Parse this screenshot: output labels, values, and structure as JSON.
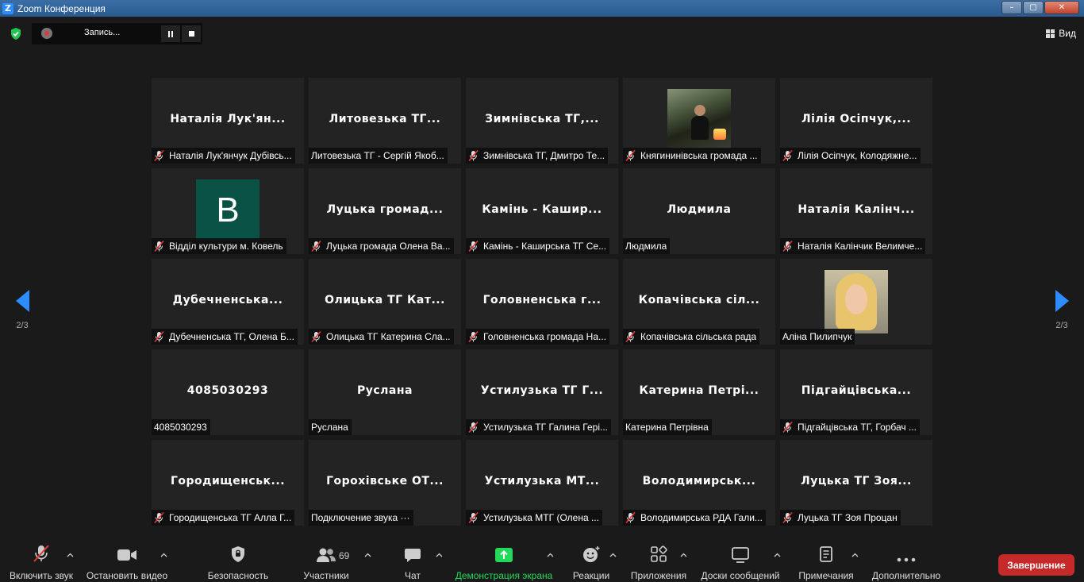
{
  "window": {
    "title": "Zoom Конференция",
    "min": "–",
    "max": "▢",
    "close": "✕"
  },
  "logo": "Z",
  "recording": {
    "label": "Запись..."
  },
  "view": {
    "label": "Вид"
  },
  "pager": {
    "left_label": "2/3",
    "right_label": "2/3"
  },
  "tiles": [
    {
      "big": "Наталія Лук'ян...",
      "name": "Наталія Лук'янчук Дубівсь...",
      "muted": true
    },
    {
      "big": "Литовезька ТГ...",
      "name": "Литовезька ТГ - Сергій Якоб...",
      "muted": false
    },
    {
      "big": "Зимнівська ТГ,...",
      "name": "Зимнівська ТГ, Дмитро Те...",
      "muted": true
    },
    {
      "big": "",
      "name": "Княгининівська громада ...",
      "muted": true,
      "photo": "photo1"
    },
    {
      "big": "Лілія Осіпчук,...",
      "name": "Лілія Осіпчук, Колодяжне...",
      "muted": true
    },
    {
      "big": "",
      "avatar_letter": "B",
      "name": "Відділ культури м. Ковель",
      "muted": true
    },
    {
      "big": "Луцька громад...",
      "name": "Луцька громада Олена Ва...",
      "muted": true
    },
    {
      "big": "Камінь - Кашир...",
      "name": "Камінь - Каширська ТГ Се...",
      "muted": true
    },
    {
      "big": "Людмила",
      "name": "Людмила",
      "muted": false
    },
    {
      "big": "Наталія Калінч...",
      "name": "Наталія Калінчик Велимче...",
      "muted": true
    },
    {
      "big": "Дубечненська...",
      "name": "Дубечненська ТГ, Олена Б...",
      "muted": true
    },
    {
      "big": "Олицька ТГ Кат...",
      "name": "Олицька ТГ Катерина Сла...",
      "muted": true
    },
    {
      "big": "Головненська г...",
      "name": "Головненська громада На...",
      "muted": true
    },
    {
      "big": "Копачівська сіл...",
      "name": "Копачівська сільська рада",
      "muted": true
    },
    {
      "big": "",
      "name": "Аліна Пилипчук",
      "muted": false,
      "photo": "photo2"
    },
    {
      "big": "4085030293",
      "name": "4085030293",
      "muted": false
    },
    {
      "big": "Руслана",
      "name": "Руслана",
      "muted": false
    },
    {
      "big": "Устилузька ТГ Г...",
      "name": "Устилузька ТГ Галина Гері...",
      "muted": true
    },
    {
      "big": "Катерина Петрі...",
      "name": "Катерина Петрівна",
      "muted": false
    },
    {
      "big": "Підгайцівська...",
      "name": "Підгайцівська ТГ, Горбач ...",
      "muted": true
    },
    {
      "big": "Городищенськ...",
      "name": "Городищенська ТГ Алла Г...",
      "muted": true
    },
    {
      "big": "Горохівське ОТ...",
      "name": "Подключение звука ···",
      "muted": false
    },
    {
      "big": "Устилузька МТ...",
      "name": "Устилузька МТГ  (Олена ...",
      "muted": true
    },
    {
      "big": "Володимирськ...",
      "name": "Володимирська РДА Гали...",
      "muted": true
    },
    {
      "big": "Луцька ТГ Зоя...",
      "name": "Луцька ТГ Зоя Процан",
      "muted": true
    }
  ],
  "toolbar": {
    "unmute": "Включить звук",
    "stop_video": "Остановить видео",
    "security": "Безопасность",
    "participants": "Участники",
    "participants_count": "69",
    "chat": "Чат",
    "share": "Демонстрация экрана",
    "reactions": "Реакции",
    "apps": "Приложения",
    "whiteboards": "Доски сообщений",
    "notes": "Примечания",
    "more": "Дополнительно",
    "end": "Завершение"
  },
  "colors": {
    "accent": "#2d8cff",
    "share_green": "#23d959",
    "end_red": "#c42a2a",
    "muted_red": "#e03a3a"
  }
}
